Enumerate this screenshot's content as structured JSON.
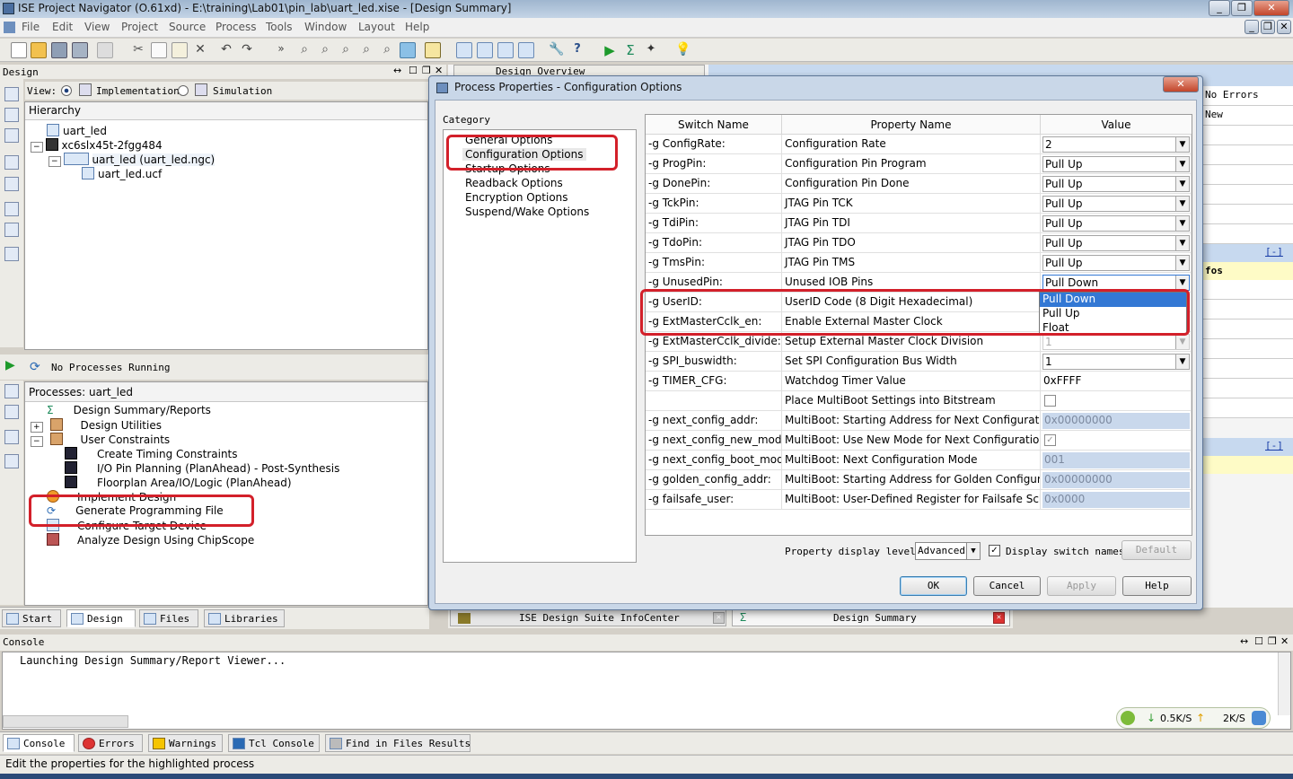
{
  "window": {
    "title": "ISE Project Navigator (O.61xd) - E:\\training\\Lab01\\pin_lab\\uart_led.xise - [Design Summary]"
  },
  "menu": [
    "File",
    "Edit",
    "View",
    "Project",
    "Source",
    "Process",
    "Tools",
    "Window",
    "Layout",
    "Help"
  ],
  "design_panel": {
    "title": "Design",
    "view_label": "View:",
    "view_options": [
      "Implementation",
      "Simulation"
    ],
    "hierarchy_label": "Hierarchy",
    "tree": [
      "uart_led",
      "xc6slx45t-2fgg484",
      "uart_led (uart_led.ngc)",
      "uart_led.ucf"
    ]
  },
  "process_panel": {
    "status": "No Processes Running",
    "processes_label": "Processes: uart_led",
    "items": [
      "Design Summary/Reports",
      "Design Utilities",
      "User Constraints",
      "Create Timing Constraints",
      "I/O Pin Planning (PlanAhead) - Post-Synthesis",
      "Floorplan Area/IO/Logic (PlanAhead)",
      "Implement Design",
      "Generate Programming File",
      "Configure Target Device",
      "Analyze Design Using ChipScope"
    ]
  },
  "left_tabs": [
    "Start",
    "Design",
    "Files",
    "Libraries"
  ],
  "design_overview": "Design Overview",
  "right_bg": {
    "no_errors": "No Errors",
    "new": "New",
    "infos": "fos",
    "collapse": "[-]"
  },
  "dialog": {
    "title": "Process Properties - Configuration Options",
    "category_label": "Category",
    "categories": [
      "General Options",
      "Configuration Options",
      "Startup Options",
      "Readback Options",
      "Encryption Options",
      "Suspend/Wake Options"
    ],
    "headers": [
      "Switch Name",
      "Property Name",
      "Value"
    ],
    "rows": [
      {
        "switch": "-g ConfigRate:",
        "prop": "Configuration Rate",
        "value": "2"
      },
      {
        "switch": "-g ProgPin:",
        "prop": "Configuration Pin Program",
        "value": "Pull Up"
      },
      {
        "switch": "-g DonePin:",
        "prop": "Configuration Pin Done",
        "value": "Pull Up"
      },
      {
        "switch": "-g TckPin:",
        "prop": "JTAG Pin TCK",
        "value": "Pull Up"
      },
      {
        "switch": "-g TdiPin:",
        "prop": "JTAG Pin TDI",
        "value": "Pull Up"
      },
      {
        "switch": "-g TdoPin:",
        "prop": "JTAG Pin TDO",
        "value": "Pull Up"
      },
      {
        "switch": "-g TmsPin:",
        "prop": "JTAG Pin TMS",
        "value": "Pull Up"
      },
      {
        "switch": "-g UnusedPin:",
        "prop": "Unused IOB Pins",
        "value": "Pull Down"
      },
      {
        "switch": "-g UserID:",
        "prop": "UserID Code (8 Digit Hexadecimal)",
        "value": ""
      },
      {
        "switch": "-g ExtMasterCclk_en:",
        "prop": "Enable External Master Clock",
        "value": ""
      },
      {
        "switch": "-g ExtMasterCclk_divide:",
        "prop": "Setup External Master Clock Division",
        "value": "1"
      },
      {
        "switch": "-g SPI_buswidth:",
        "prop": "Set SPI Configuration Bus Width",
        "value": "1"
      },
      {
        "switch": "-g TIMER_CFG:",
        "prop": "Watchdog Timer Value",
        "value": "0xFFFF"
      },
      {
        "switch": "",
        "prop": "Place MultiBoot Settings into Bitstream",
        "value": ""
      },
      {
        "switch": "-g next_config_addr:",
        "prop": "MultiBoot: Starting Address for Next Configuration",
        "value": "0x00000000"
      },
      {
        "switch": "-g next_config_new_mode:",
        "prop": "MultiBoot: Use New Mode for Next Configuration",
        "value": "✓"
      },
      {
        "switch": "-g next_config_boot_mode:",
        "prop": "MultiBoot: Next Configuration Mode",
        "value": "001"
      },
      {
        "switch": "-g golden_config_addr:",
        "prop": "MultiBoot: Starting Address for Golden Configuration",
        "value": "0x00000000"
      },
      {
        "switch": "-g failsafe_user:",
        "prop": "MultiBoot: User-Defined Register for Failsafe Scheme",
        "value": "0x0000"
      }
    ],
    "dropdown_options": [
      "Pull Down",
      "Pull Up",
      "Float"
    ],
    "display_level_label": "Property display level:",
    "display_level_value": "Advanced",
    "display_switch_label": "Display switch names",
    "buttons": {
      "default": "Default",
      "ok": "OK",
      "cancel": "Cancel",
      "apply": "Apply",
      "help": "Help"
    }
  },
  "doc_tabs": [
    "ISE Design Suite InfoCenter",
    "Design Summary"
  ],
  "console": {
    "title": "Console",
    "text": "Launching Design Summary/Report Viewer...",
    "tabs": [
      "Console",
      "Errors",
      "Warnings",
      "Tcl Console",
      "Find in Files Results"
    ]
  },
  "net": {
    "down": "0.5K/S",
    "up": "2K/S"
  },
  "status": "Edit the properties for the highlighted process"
}
